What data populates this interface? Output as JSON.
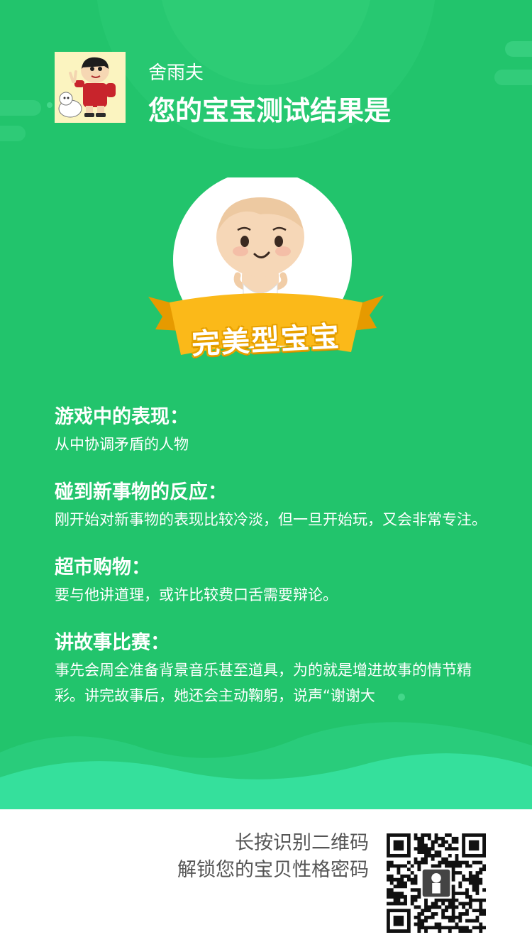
{
  "header": {
    "user_name": "舍雨夫",
    "headline": "您的宝宝测试结果是"
  },
  "result": {
    "title": "完美型宝宝"
  },
  "sections": [
    {
      "title": "游戏中的表现：",
      "body": "从中协调矛盾的人物"
    },
    {
      "title": "碰到新事物的反应：",
      "body": "刚开始对新事物的表现比较冷淡，但一旦开始玩，又会非常专注。"
    },
    {
      "title": "超市购物：",
      "body": "要与他讲道理，或许比较费口舌需要辩论。"
    },
    {
      "title": "讲故事比赛：",
      "body": "事先会周全准备背景音乐甚至道具，为的就是增进故事的情节精彩。讲完故事后，她还会主动鞠躬，说声“谢谢大"
    }
  ],
  "footer": {
    "line1": "长按识别二维码",
    "line2": "解锁您的宝贝性格密码"
  },
  "colors": {
    "background": "#22c46c",
    "ribbon": "#fbb919",
    "text": "#ffffff",
    "footer_text": "#555555"
  },
  "icons": {
    "avatar": "cartoon-boy-with-dog",
    "hero": "baby-in-diaper",
    "qr": "qr-code"
  }
}
